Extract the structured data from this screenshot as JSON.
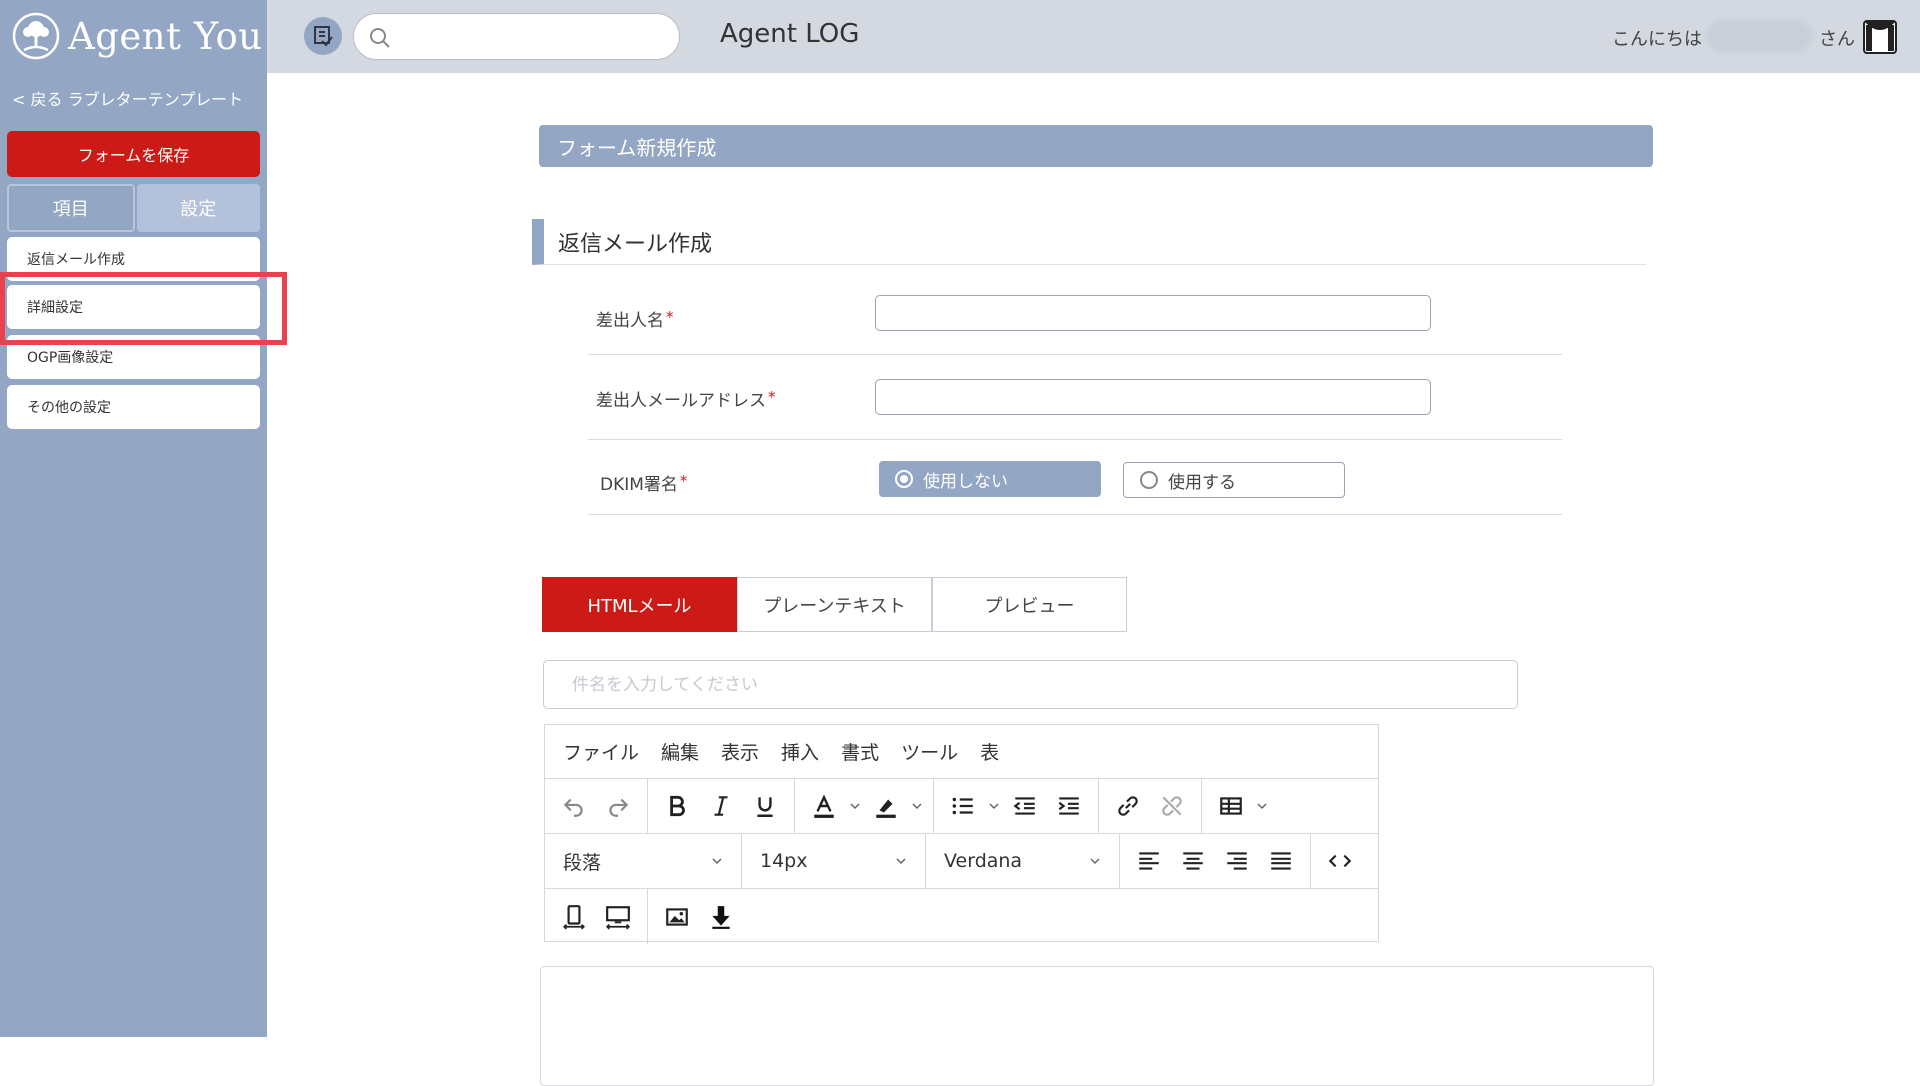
{
  "sidebar": {
    "logo_text": "Agent You",
    "back_link": "< 戻る ラブレターテンプレート",
    "save_button": "フォームを保存",
    "tabs": [
      {
        "label": "項目"
      },
      {
        "label": "設定"
      }
    ],
    "menu": [
      {
        "label": "返信メール作成"
      },
      {
        "label": "詳細設定"
      },
      {
        "label": "OGP画像設定"
      },
      {
        "label": "その他の設定"
      }
    ]
  },
  "topbar": {
    "search_placeholder": "",
    "title": "Agent LOG",
    "greeting": "こんにちは",
    "honorific": "さん"
  },
  "main": {
    "page_header": "フォーム新規作成",
    "section_title": "返信メール作成",
    "fields": [
      {
        "label": "差出人名",
        "required": "*",
        "value": ""
      },
      {
        "label": "差出人メールアドレス",
        "required": "*",
        "value": ""
      }
    ],
    "dkim": {
      "label": "DKIM署名",
      "required": "*",
      "options": [
        {
          "label": "使用しない",
          "selected": true
        },
        {
          "label": "使用する",
          "selected": false
        }
      ]
    },
    "mail_tabs": [
      {
        "label": "HTMLメール"
      },
      {
        "label": "プレーンテキスト"
      },
      {
        "label": "プレビュー"
      }
    ],
    "subject_placeholder": "件名を入力してください",
    "editor": {
      "menu": [
        "ファイル",
        "編集",
        "表示",
        "挿入",
        "書式",
        "ツール",
        "表"
      ],
      "block_format": "段落",
      "font_size": "14px",
      "font_family": "Verdana"
    }
  },
  "colors": {
    "sidebar": "#93a6c4",
    "accent_red": "#cc1a16",
    "topbar": "#d3d8e1",
    "highlight": "#e8424e"
  }
}
